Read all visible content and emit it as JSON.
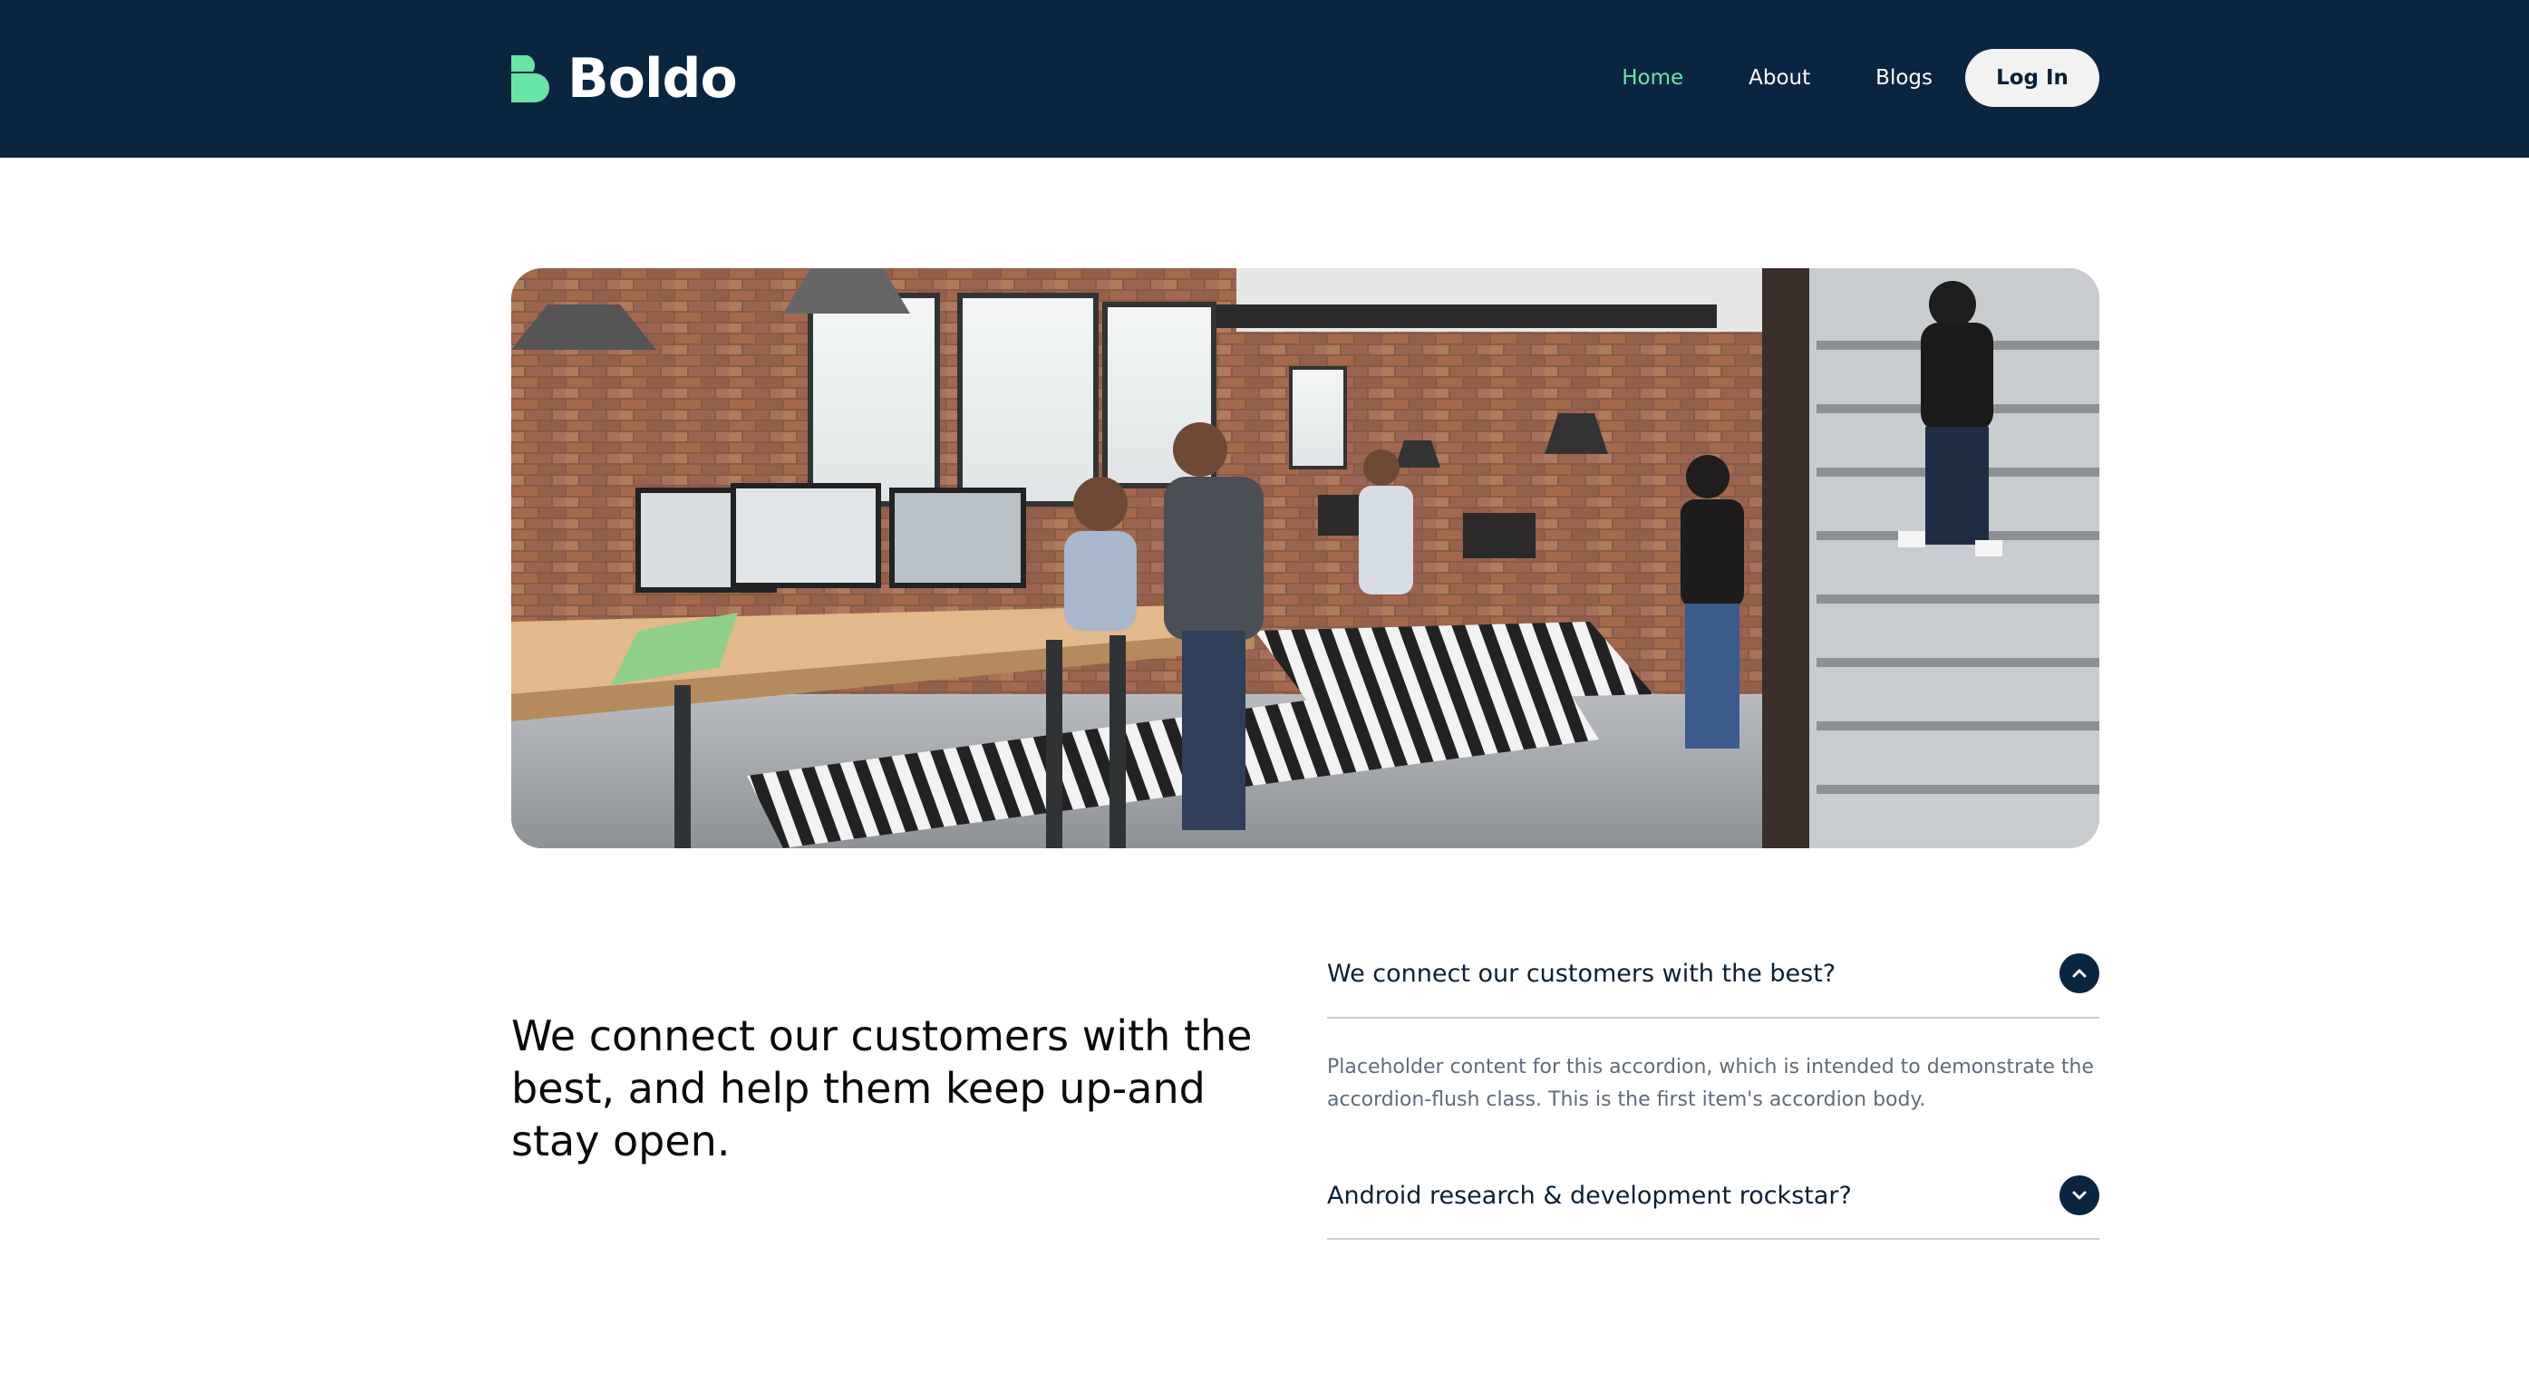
{
  "brand": {
    "name": "Boldo",
    "logo_icon": "boldo-b-logo-icon",
    "accent_color": "#69e6a6",
    "header_bg": "#0a2540"
  },
  "nav": {
    "items": [
      {
        "label": "Home",
        "active": true
      },
      {
        "label": "About",
        "active": false
      },
      {
        "label": "Blogs",
        "active": false
      }
    ],
    "login_label": "Log In"
  },
  "hero": {
    "image": "office-coworking-photo"
  },
  "tagline": "We connect our customers with the best, and help them keep up-and stay open.",
  "accordion": {
    "items": [
      {
        "title": "We connect our customers with the best?",
        "expanded": true,
        "toggle_icon": "chevron-up-icon",
        "body": "Placeholder content for this accordion, which is intended to demonstrate the accordion-flush class. This is the first item's accordion body."
      },
      {
        "title": "Android research & development rockstar?",
        "expanded": false,
        "toggle_icon": "chevron-down-icon",
        "body": ""
      }
    ]
  }
}
